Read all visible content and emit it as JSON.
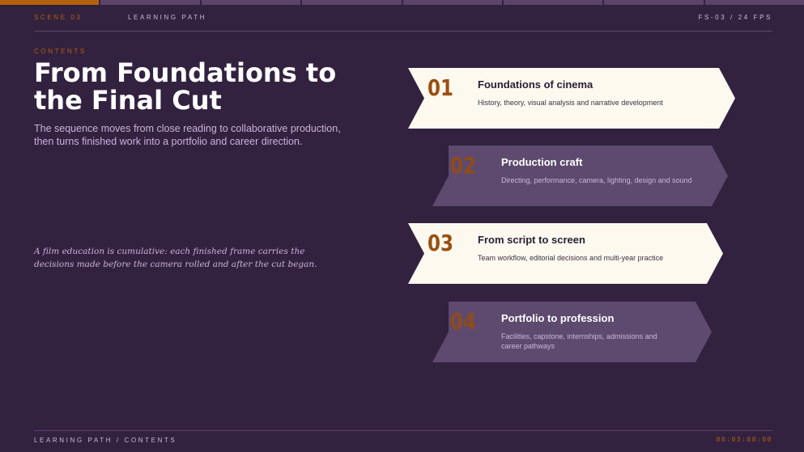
{
  "progress": {
    "segments": 8,
    "active_index": 0
  },
  "header": {
    "scene": "SCENE 03",
    "path": "LEARNING PATH",
    "fps": "FS-03 / 24 FPS"
  },
  "content": {
    "kicker": "CONTENTS",
    "title": "From Foundations to the Final Cut",
    "subtitle": "The sequence moves from close reading to collaborative production, then turns finished work into a portfolio and career direction.",
    "quote": "A film education is cumulative: each finished frame carries the decisions made before the camera rolled and after the cut began."
  },
  "steps": [
    {
      "number": "01",
      "title": "Foundations of cinema",
      "description": "History, theory, visual analysis and narrative development"
    },
    {
      "number": "02",
      "title": "Production craft",
      "description": "Directing, performance, camera, lighting, design and sound"
    },
    {
      "number": "03",
      "title": "From script to screen",
      "description": "Team workflow, editorial decisions and multi-year practice"
    },
    {
      "number": "04",
      "title": "Portfolio to profession",
      "description": "Facilities, capstone, internships, admissions and career pathways"
    }
  ],
  "footer": {
    "label": "LEARNING PATH / CONTENTS",
    "timecode": "00:03:00:00"
  },
  "colors": {
    "background": "#33223f",
    "accent": "#b3600e",
    "light_card": "#fdf9ef",
    "dark_card": "#5e4a6e"
  }
}
